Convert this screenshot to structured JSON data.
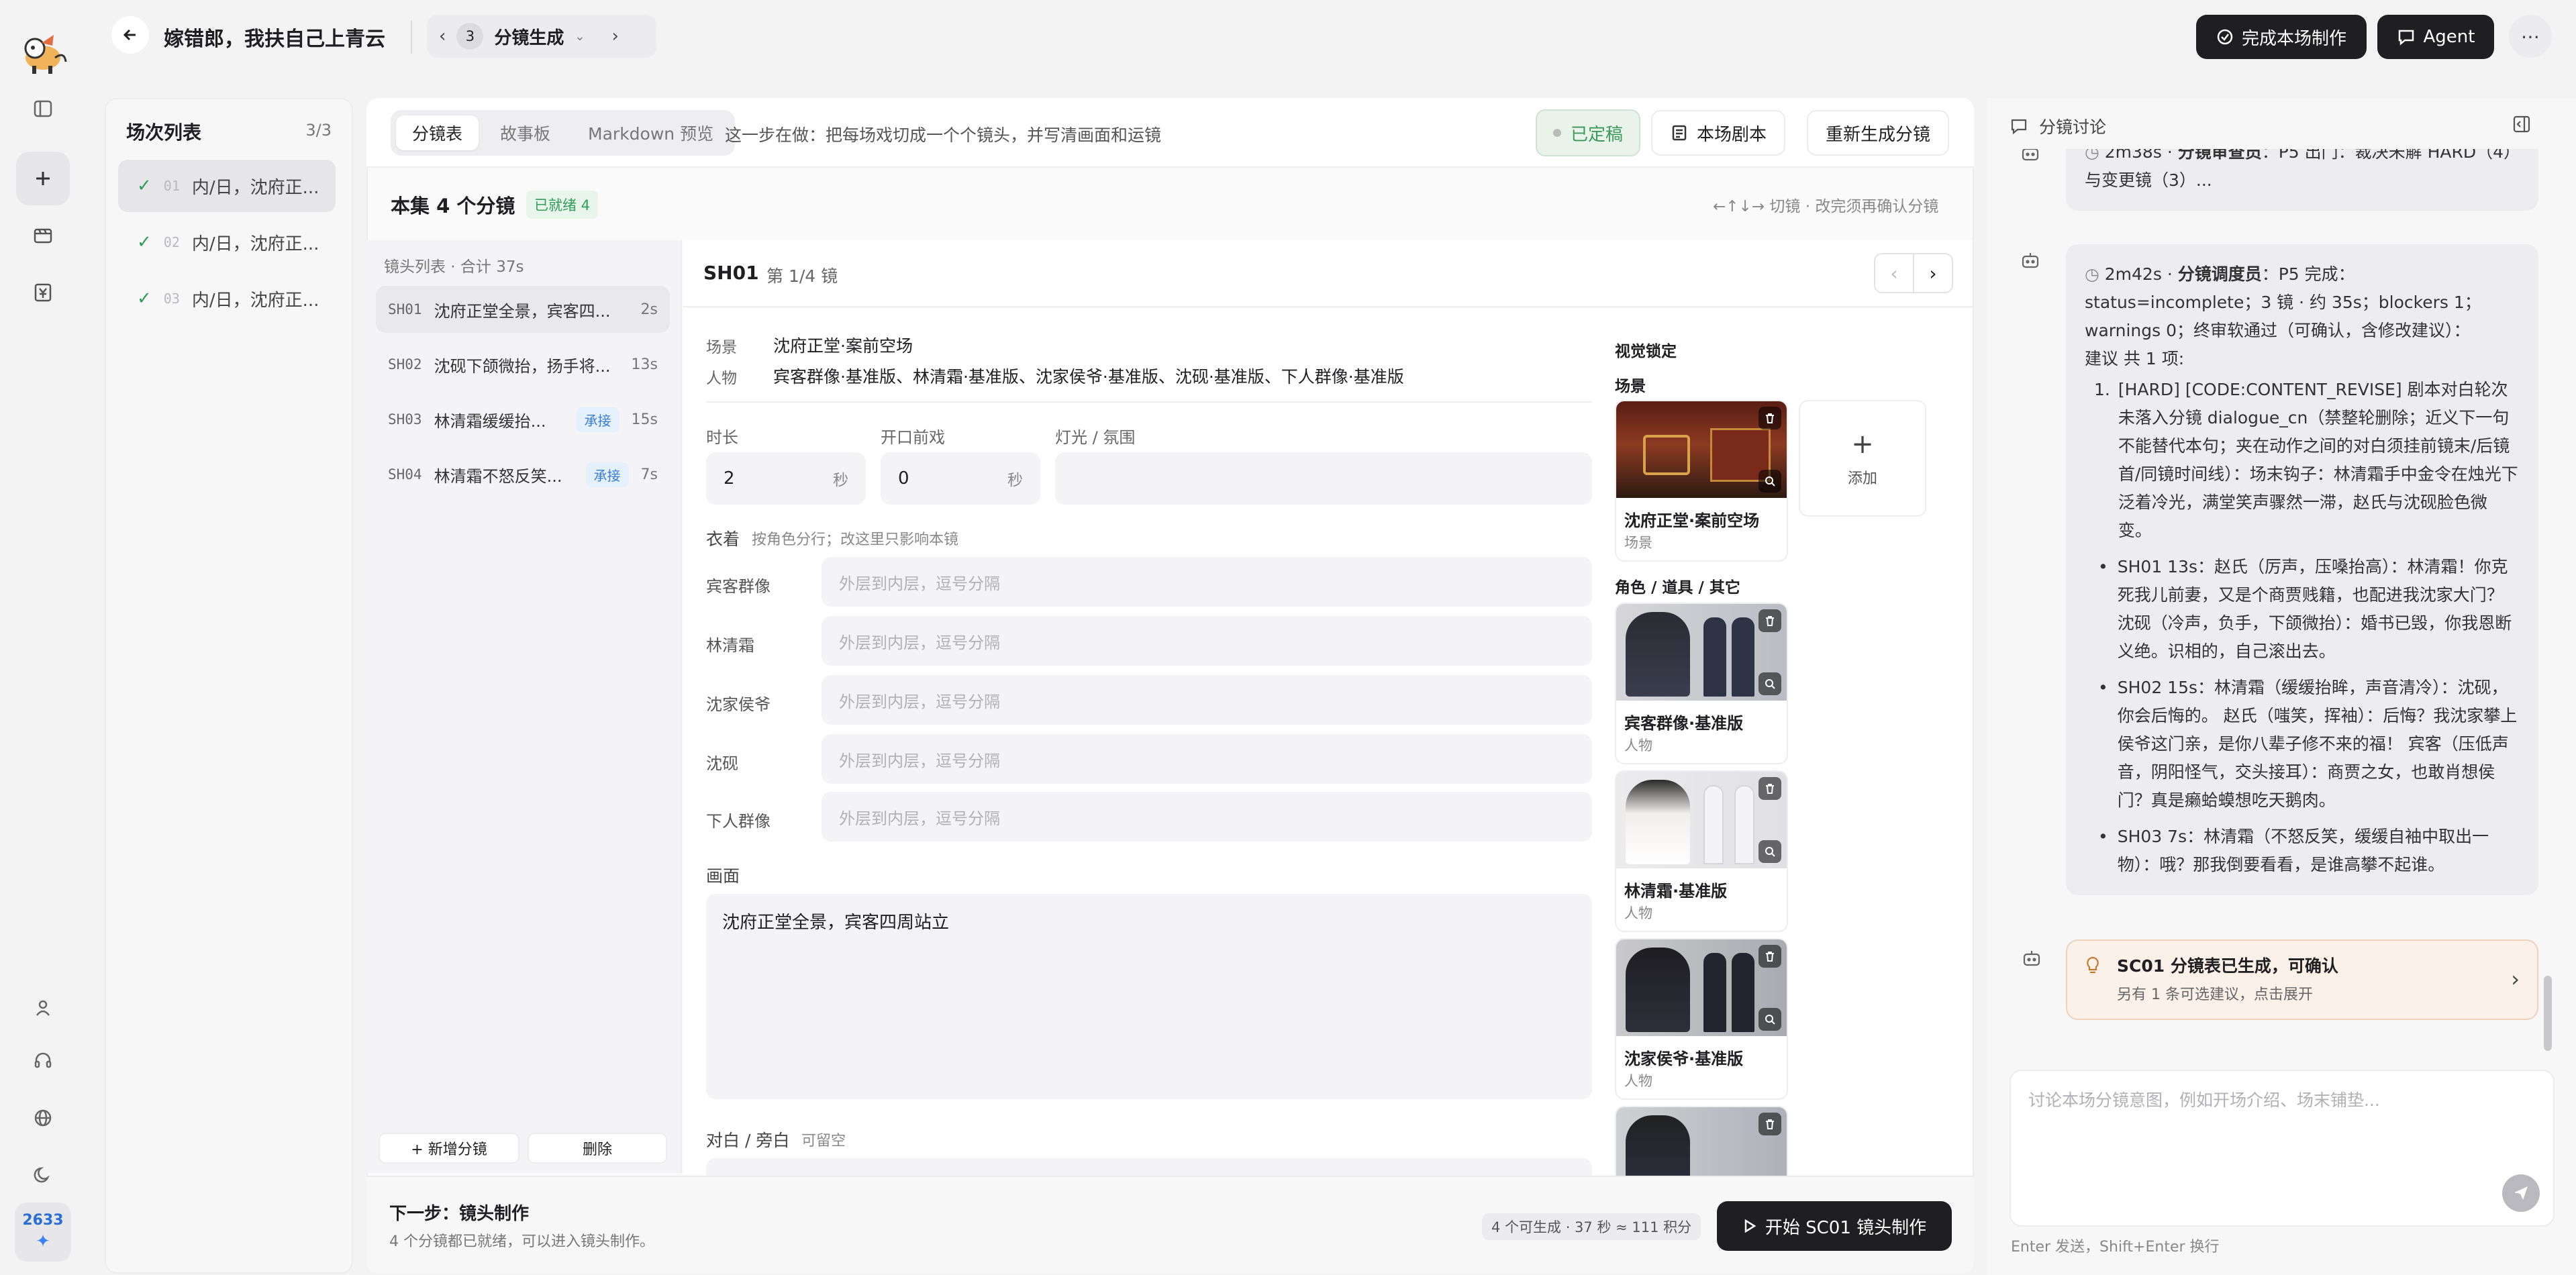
{
  "topbar": {
    "title": "嫁错郎，我扶自己上青云",
    "step_num": "3",
    "step_label": "分镜生成",
    "complete_btn": "完成本场制作",
    "agent_btn": "Agent"
  },
  "rail": {
    "badge_count": "2633"
  },
  "scenes": {
    "title": "场次列表",
    "count": "3/3",
    "items": [
      {
        "num": "01",
        "label": "内/日，沈府正..."
      },
      {
        "num": "02",
        "label": "内/日，沈府正..."
      },
      {
        "num": "03",
        "label": "内/日，沈府正..."
      }
    ]
  },
  "main": {
    "tabs": [
      "分镜表",
      "故事板",
      "Markdown 预览"
    ],
    "hint": "这一步在做：把每场戏切成一个个镜头，并写清画面和运镜",
    "status_btn": "已定稿",
    "script_btn": "本场剧本",
    "regen_btn": "重新生成分镜",
    "summary_title": "本集 4 个分镜",
    "ready_badge": "已就绪 4",
    "keys_hint": "←↑↓→ 切镜 · 改完须再确认分镜",
    "list_header": "镜头列表 · 合计 37s",
    "shots": [
      {
        "id": "SH01",
        "title": "沈府正堂全景，宾客四...",
        "tag": "",
        "dur": "2s"
      },
      {
        "id": "SH02",
        "title": "沈砚下颌微抬，扬手将...",
        "tag": "",
        "dur": "13s"
      },
      {
        "id": "SH03",
        "title": "林清霜缓缓抬...",
        "tag": "承接",
        "dur": "15s"
      },
      {
        "id": "SH04",
        "title": "林清霜不怒反笑...",
        "tag": "承接",
        "dur": "7s"
      }
    ],
    "add_shot": "+ 新增分镜",
    "delete_shot": "删除",
    "detail_id": "SH01",
    "detail_pos": "第 1/4 镜",
    "scene_label": "场景",
    "scene_value": "沈府正堂·案前空场",
    "people_label": "人物",
    "people_value": "宾客群像·基准版、林清霜·基准版、沈家侯爷·基准版、沈砚·基准版、下人群像·基准版",
    "duration_label": "时长",
    "duration_value": "2",
    "duration_unit": "秒",
    "pre_label": "开口前戏",
    "pre_value": "0",
    "pre_unit": "秒",
    "light_label": "灯光 / 氛围",
    "wardrobe_label": "衣着",
    "wardrobe_hint": "按角色分行；改这里只影响本镜",
    "wardrobe_placeholder": "外层到内层，逗号分隔",
    "wardrobe_roles": [
      "宾客群像",
      "林清霜",
      "沈家侯爷",
      "沈砚",
      "下人群像"
    ],
    "frame_label": "画面",
    "frame_value": "沈府正堂全景，宾客四周站立",
    "dialog_label": "对白 / 旁白",
    "dialog_hint": "可留空",
    "lock_title": "视觉锁定",
    "lock_scene": "场景",
    "lock_chars": "角色 / 道具 / 其它",
    "add_label": "添加",
    "assets": [
      {
        "name": "沈府正堂·案前空场",
        "type": "场景"
      },
      {
        "name": "宾客群像·基准版",
        "type": "人物"
      },
      {
        "name": "林清霜·基准版",
        "type": "人物"
      },
      {
        "name": "沈家侯爷·基准版",
        "type": "人物"
      }
    ],
    "next_title": "下一步：镜头制作",
    "next_desc": "4 个分镜都已就绪，可以进入镜头制作。",
    "cost": "4 个可生成 · 37 秒 ≈ 111 积分",
    "start_btn": "开始 SC01 镜头制作"
  },
  "chat": {
    "title": "分镜讨论",
    "msg1_time": "2m38s",
    "msg1_role": "分镜审查员",
    "msg1_text": "：P5 出门：裁决未解 HARD（4）与变更镜（3）...",
    "msg2_time": "2m42s",
    "msg2_role": "分镜调度员",
    "msg2_text": "：P5 完成：status=incomplete；3 镜 · 约 35s；blockers 1；warnings 0；终审软通过（可确认，含修改建议）：",
    "msg2_sub": "建议 共 1 项:",
    "msg2_item": "[HARD] [CODE:CONTENT_REVISE] 剧本对白轮次未落入分镜 dialogue_cn（禁整轮删除；近义下一句不能替代本句；夹在动作之间的对白须挂前镜末/后镜首/同镜时间线）：场末钩子：林清霜手中金令在烛光下泛着冷光，满堂笑声骤然一滞，赵氏与沈砚脸色微变。",
    "bullets": [
      "SH01 13s：赵氏（厉声，压嗓抬高）：林清霜！你克死我儿前妻，又是个商贾贱籍，也配进我沈家大门？ 沈砚（冷声，负手，下颌微抬）：婚书已毁，你我恩断义绝。识相的，自己滚出去。",
      "SH02 15s：林清霜（缓缓抬眸，声音清冷）：沈砚，你会后悔的。 赵氏（嗤笑，挥袖）：后悔？我沈家攀上侯爷这门亲，是你八辈子修不来的福！ 宾客（压低声音，阴阳怪气，交头接耳）：商贾之女，也敢肖想侯门？真是癞蛤蟆想吃天鹅肉。",
      "SH03 7s：林清霜（不怒反笑，缓缓自袖中取出一物）：哦？那我倒要看看，是谁高攀不起谁。"
    ],
    "notice_title": "SC01 分镜表已生成，可确认",
    "notice_sub": "另有 1 条可选建议，点击展开",
    "input_placeholder": "讨论本场分镜意图，例如开场介绍、场末铺垫...",
    "footer_hint": "Enter 发送，Shift+Enter 换行"
  }
}
